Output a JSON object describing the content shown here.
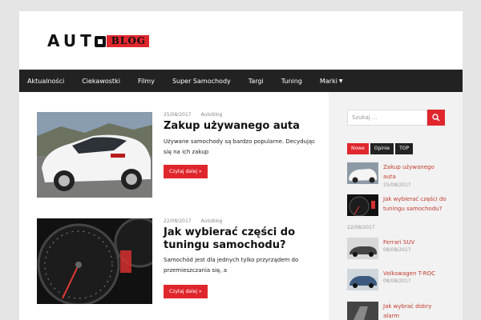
{
  "brand": {
    "logo_text": "AUTO BLOG",
    "accent": "#e0262d"
  },
  "nav": {
    "items": [
      "Aktualności",
      "Ciekawostki",
      "Filmy",
      "Super Samochody",
      "Targi",
      "Tuning",
      "Marki"
    ]
  },
  "posts": [
    {
      "date": "25/08/2017",
      "author": "Autoblog",
      "title": "Zakup używanego auta",
      "excerpt": "Używane samochody są bardzo popularne. Decydując się na ich zakup",
      "button": "Czytaj dalej »"
    },
    {
      "date": "22/08/2017",
      "author": "Autoblog",
      "title": "Jak wybierać części do tuningu samochodu?",
      "excerpt": "Samochód jest dla jednych tylko przyrządem do przemieszczania się, a",
      "button": "Czytaj dalej »"
    }
  ],
  "sidebar": {
    "search_placeholder": "Szukaj ...",
    "tabs": [
      "Nowe",
      "Opinie",
      "TOP"
    ],
    "items": [
      {
        "title": "Zakup używanego auta",
        "date": "25/08/2017"
      },
      {
        "title": "Jak wybierać części do tuningu samochodu?",
        "date": "22/08/2017"
      },
      {
        "title": "Ferrari SUV",
        "date": "08/08/2017"
      },
      {
        "title": "Volkswagen T-ROC",
        "date": "08/08/2017"
      },
      {
        "title": "Jak wybrać dobry alarm",
        "date": ""
      }
    ]
  }
}
